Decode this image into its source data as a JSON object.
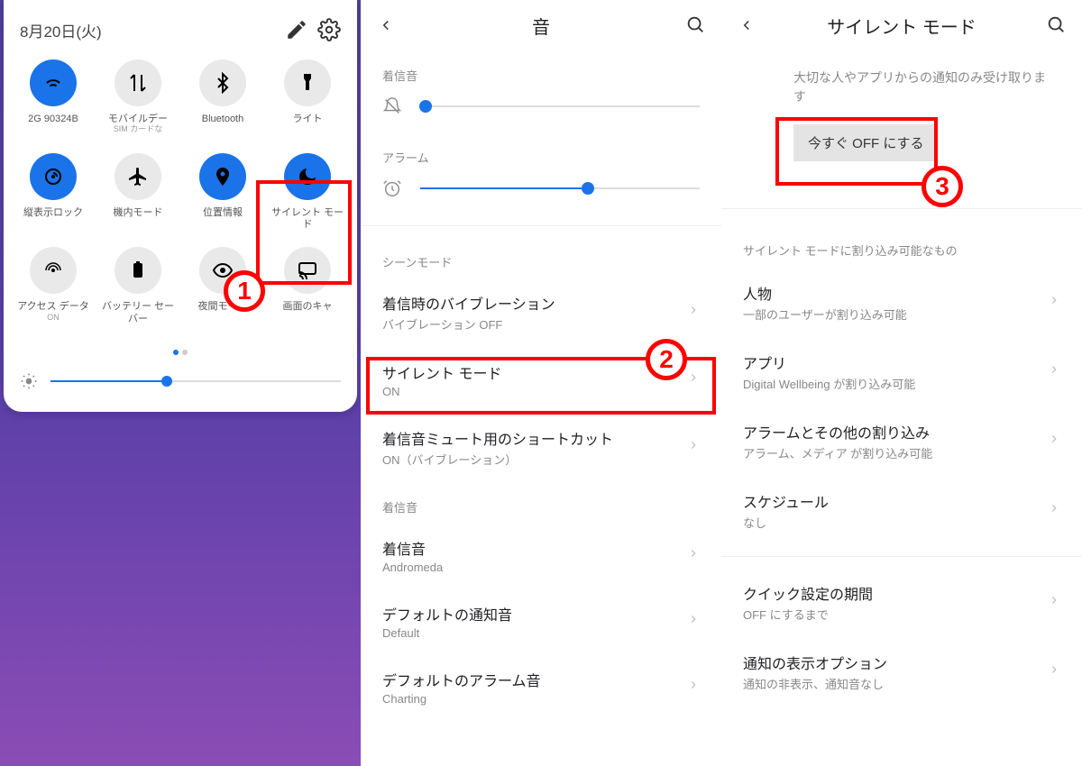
{
  "panel1": {
    "date": "8月20日(火)",
    "tiles": [
      {
        "label": "2G   90324B",
        "sub": "",
        "on": true,
        "icon": "wifi"
      },
      {
        "label": "モバイルデー",
        "sub": "SIM カードな",
        "on": false,
        "icon": "swap"
      },
      {
        "label": "Bluetooth",
        "sub": "",
        "on": false,
        "icon": "bluetooth"
      },
      {
        "label": "ライト",
        "sub": "",
        "on": false,
        "icon": "flashlight"
      },
      {
        "label": "縦表示ロック",
        "sub": "",
        "on": true,
        "icon": "rotate"
      },
      {
        "label": "機内モード",
        "sub": "",
        "on": false,
        "icon": "airplane"
      },
      {
        "label": "位置情報",
        "sub": "",
        "on": true,
        "icon": "location"
      },
      {
        "label": "サイレント モード",
        "sub": "",
        "on": true,
        "icon": "moon"
      },
      {
        "label": "アクセス データ",
        "sub": "ON",
        "on": false,
        "icon": "hotspot",
        "dim": true
      },
      {
        "label": "バッテリー セーバー",
        "sub": "",
        "on": false,
        "icon": "battery",
        "dim": true
      },
      {
        "label": "夜間モード",
        "sub": "",
        "on": false,
        "icon": "eye",
        "dim": true
      },
      {
        "label": "画面のキャ",
        "sub": "",
        "on": false,
        "icon": "cast",
        "dim": true
      }
    ]
  },
  "panel2": {
    "title": "音",
    "ringtone_label": "着信音",
    "alarm_label": "アラーム",
    "scene_label": "シーンモード",
    "rows": [
      {
        "title": "着信時のバイブレーション",
        "sub": "バイブレーション OFF"
      },
      {
        "title": "サイレント モード",
        "sub": "ON"
      },
      {
        "title": "着信音ミュート用のショートカット",
        "sub": "ON（バイブレーション）"
      }
    ],
    "ring_section": "着信音",
    "rows2": [
      {
        "title": "着信音",
        "sub": "Andromeda"
      },
      {
        "title": "デフォルトの通知音",
        "sub": "Default"
      },
      {
        "title": "デフォルトのアラーム音",
        "sub": "Charting"
      }
    ]
  },
  "panel3": {
    "title": "サイレント モード",
    "desc": "大切な人やアプリからの通知のみ受け取ります",
    "button": "今すぐ OFF にする",
    "section1": "サイレント モードに割り込み可能なもの",
    "rows": [
      {
        "title": "人物",
        "sub": "一部のユーザーが割り込み可能"
      },
      {
        "title": "アプリ",
        "sub": "Digital Wellbeing が割り込み可能"
      },
      {
        "title": "アラームとその他の割り込み",
        "sub": "アラーム、メディア が割り込み可能"
      },
      {
        "title": "スケジュール",
        "sub": "なし"
      }
    ],
    "rows2": [
      {
        "title": "クイック設定の期間",
        "sub": "OFF にするまで"
      },
      {
        "title": "通知の表示オプション",
        "sub": "通知の非表示、通知音なし"
      }
    ]
  },
  "anno": {
    "n1": "1",
    "n2": "2",
    "n3": "3"
  }
}
